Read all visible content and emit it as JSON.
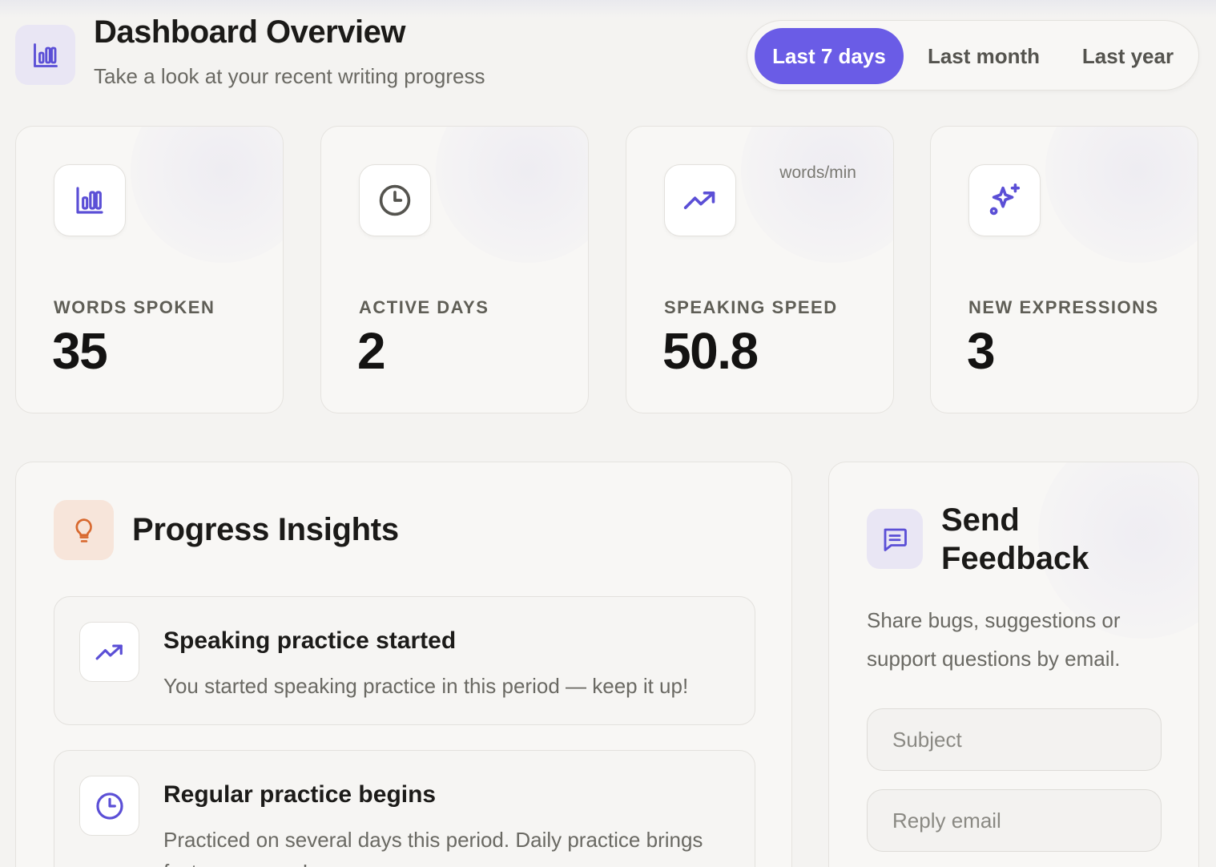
{
  "header": {
    "title": "Dashboard Overview",
    "subtitle": "Take a look at your recent writing progress",
    "icon": "bar-chart-icon"
  },
  "range_switch": {
    "options": [
      "Last 7 days",
      "Last month",
      "Last year"
    ],
    "selected": "Last 7 days"
  },
  "stats": [
    {
      "label": "WORDS SPOKEN",
      "value": "35",
      "unit": "",
      "icon": "bar-chart-icon"
    },
    {
      "label": "ACTIVE DAYS",
      "value": "2",
      "unit": "",
      "icon": "clock-icon"
    },
    {
      "label": "SPEAKING SPEED",
      "value": "50.8",
      "unit": "words/min",
      "icon": "trending-up-icon"
    },
    {
      "label": "NEW EXPRESSIONS",
      "value": "3",
      "unit": "",
      "icon": "sparkles-icon"
    }
  ],
  "insights": {
    "title": "Progress Insights",
    "icon": "lightbulb-icon",
    "items": [
      {
        "title": "Speaking practice started",
        "description": "You started speaking practice in this period — keep it up!",
        "icon": "trending-up-icon"
      },
      {
        "title": "Regular practice begins",
        "description": "Practiced on several days this period. Daily practice brings faster progress!",
        "icon": "clock-icon"
      }
    ]
  },
  "feedback": {
    "title": "Send Feedback",
    "description": "Share bugs, suggestions or support questions by email.",
    "icon": "message-square-icon",
    "subject_placeholder": "Subject",
    "email_placeholder": "Reply email"
  },
  "colors": {
    "accent": "#6a5ce6",
    "accent_icon": "#5b4fd6",
    "warm_icon": "#d8692f",
    "neutral_icon": "#55544f"
  }
}
